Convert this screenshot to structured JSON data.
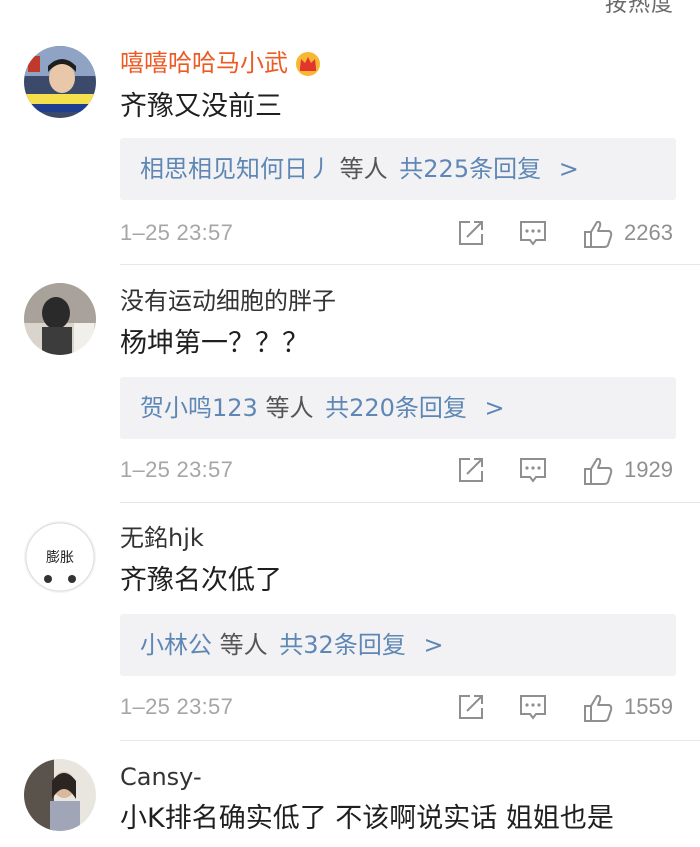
{
  "header": {
    "sort_label": "按热度"
  },
  "comments": [
    {
      "user": "嘻嘻哈哈马小武",
      "text": "齐豫又没前三",
      "reply_users": "相思相见知何日丿",
      "reply_etc": "等人",
      "reply_count": "共225条回复",
      "reply_arrow": ">",
      "time": "1–25 23:57",
      "likes": "2263",
      "vip": true
    },
    {
      "user": "没有运动细胞的胖子",
      "text": "杨坤第一？？？",
      "reply_users": "贺小鸣123",
      "reply_etc": "等人",
      "reply_count": "共220条回复",
      "reply_arrow": ">",
      "time": "1–25 23:57",
      "likes": "1929",
      "vip": false
    },
    {
      "user": "无銘hjk",
      "text": "齐豫名次低了",
      "avatar_text": "膨胀",
      "reply_users": "小林公",
      "reply_etc": "等人",
      "reply_count": "共32条回复",
      "reply_arrow": ">",
      "time": "1–25 23:57",
      "likes": "1559",
      "vip": false
    },
    {
      "user": "Cansy-",
      "text": "小K排名确实低了 不该啊说实话 姐姐也是",
      "vip": false
    }
  ],
  "colors": {
    "vip_name": "#ee5a24",
    "link": "#5f87b5",
    "meta": "#a6a6a6",
    "reply_bg": "#f2f2f4"
  }
}
